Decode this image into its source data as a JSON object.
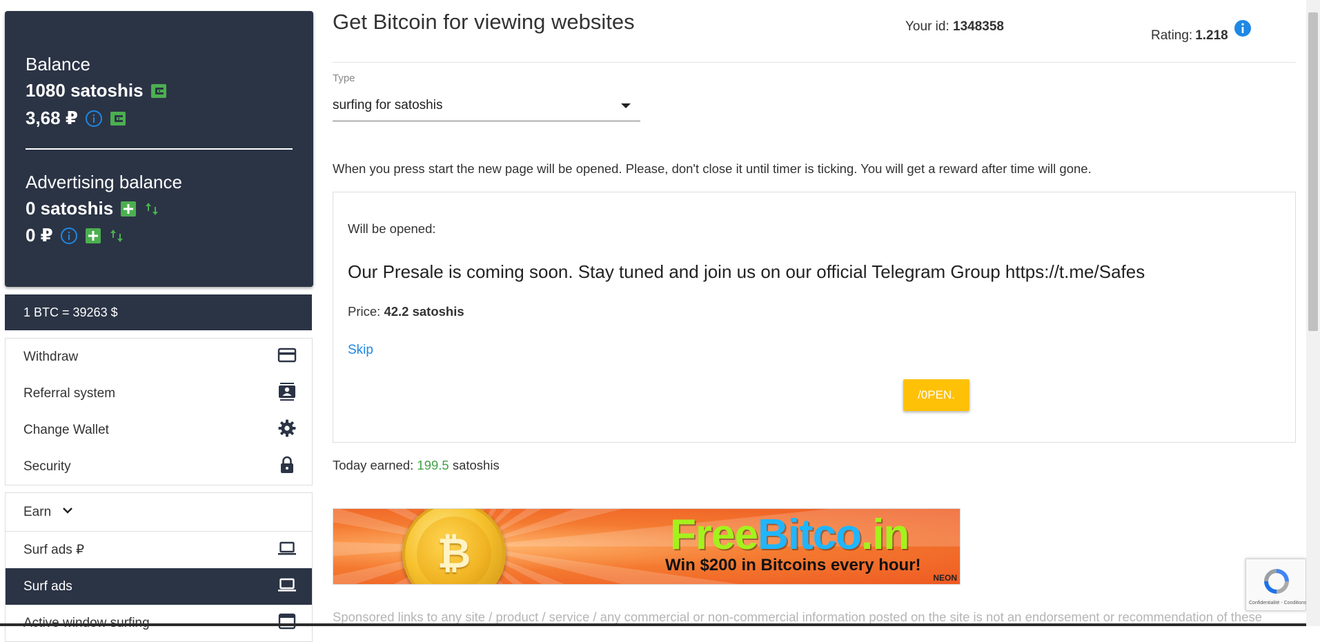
{
  "sidebar": {
    "balance": {
      "title": "Balance",
      "satoshis": "1080 satoshis",
      "rub": "3,68 ₽"
    },
    "advertising": {
      "title": "Advertising balance",
      "satoshis": "0 satoshis",
      "rub": "0 ₽"
    },
    "rate": "1 BTC = 39263 $",
    "account_menu": [
      {
        "label": "Withdraw",
        "icon": "credit-card-icon"
      },
      {
        "label": "Referral system",
        "icon": "contacts-icon"
      },
      {
        "label": "Change Wallet",
        "icon": "gear-icon"
      },
      {
        "label": "Security",
        "icon": "lock-icon"
      }
    ],
    "earn_label": "Earn",
    "earn_menu": [
      {
        "label": "Surf ads ₽",
        "icon": "laptop-icon",
        "active": false
      },
      {
        "label": "Surf ads",
        "icon": "laptop-icon",
        "active": true
      },
      {
        "label": "Active window surfing",
        "icon": "window-icon",
        "active": false
      }
    ]
  },
  "header": {
    "title": "Get Bitcoin for viewing websites",
    "id_label": "Your id:",
    "id_value": "1348358",
    "rating_label": "Rating:",
    "rating_value": "1.218"
  },
  "type_select": {
    "label": "Type",
    "value": "surfing for satoshis"
  },
  "instructions": "When you press start the new page will be opened. Please, don't close it until timer is ticking. You will get a reward after time will gone.",
  "task": {
    "will_open_label": "Will be opened:",
    "site_title": "Our Presale is coming soon. Stay tuned and join us on our official Telegram Group https://t.me/Safes",
    "price_label": "Price:",
    "price_value": "42.2 satoshis",
    "skip_label": "Skip",
    "open_label": "/0PEN."
  },
  "today": {
    "label": "Today earned:",
    "value": "199.5",
    "unit": "satoshis"
  },
  "banner": {
    "logo_part1": "Free",
    "logo_part2": "Bitco",
    "logo_part3": ".in",
    "tagline": "Win $200 in Bitcoins every hour!",
    "badge": "NEON"
  },
  "sponsored_text": "Sponsored links to any site / product / service / any commercial or non-commercial information posted on the site is not an endorsement or recommendation of these",
  "recaptcha": {
    "footer": "Confidentialité - Conditions"
  },
  "colors": {
    "sidebar_bg": "#2b3445",
    "accent_green": "#43a047",
    "accent_blue": "#1e88e5",
    "open_button": "#ffc107"
  }
}
